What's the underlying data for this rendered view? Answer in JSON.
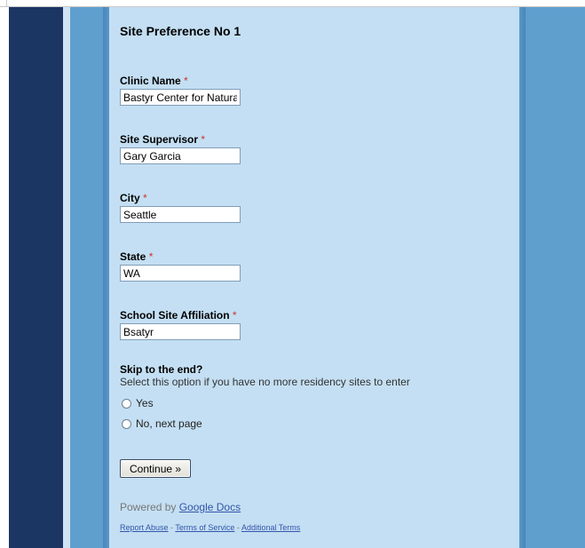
{
  "form": {
    "title": "Site Preference No 1",
    "required_marker": "*",
    "fields": [
      {
        "label": "Clinic Name",
        "value": "Bastyr Center for Natural H"
      },
      {
        "label": "Site Supervisor",
        "value": "Gary Garcia"
      },
      {
        "label": "City",
        "value": "Seattle"
      },
      {
        "label": "State",
        "value": "WA"
      },
      {
        "label": "School Site Affiliation",
        "value": "Bsatyr"
      }
    ],
    "skip": {
      "title": "Skip to the end?",
      "help": "Select this option if you have no more residency sites to enter",
      "options": [
        "Yes",
        "No, next page"
      ]
    },
    "continue_label": "Continue »"
  },
  "footer": {
    "powered_prefix": "Powered by",
    "powered_link": "Google Docs",
    "report_abuse": "Report Abuse",
    "separator": " - ",
    "terms": "Terms of Service",
    "additional_terms": "Additional Terms"
  },
  "colors": {
    "left_band": "#1c3664",
    "outer_background": "#5f9fce",
    "card_background": "#c4dff3",
    "required_color": "#cc3333",
    "link_color": "#3355aa"
  }
}
